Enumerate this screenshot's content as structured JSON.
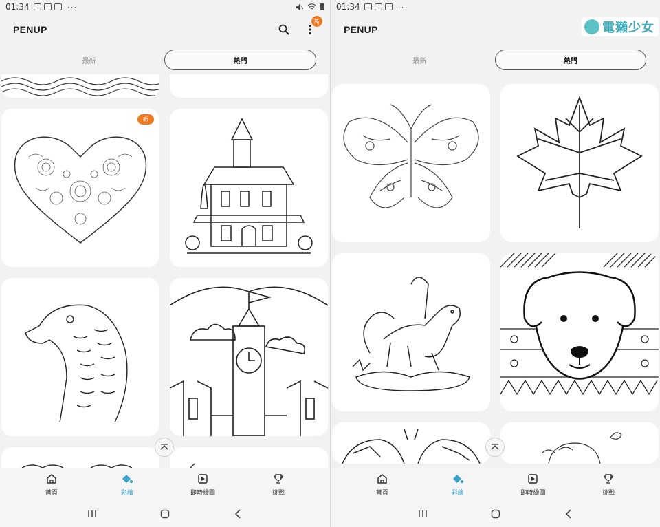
{
  "status_left": {
    "time": "01:34",
    "dots": "···"
  },
  "status_right": {
    "time": "01:34",
    "dots": "···"
  },
  "app": {
    "title": "PENUP",
    "new_badge": "新"
  },
  "tabs": {
    "latest": "最新",
    "popular": "熱門"
  },
  "card_badge": "新",
  "watermark": {
    "text": "電獺少女"
  },
  "nav": {
    "home": "首頁",
    "coloring": "彩繪",
    "live": "即時繪圖",
    "challenge": "挑戰"
  },
  "colors": {
    "accent": "#3aa3c8",
    "badge": "#f07a22",
    "background": "#f2f2f2"
  },
  "icons": [
    "search-icon",
    "more-icon",
    "home-icon",
    "coloring-icon",
    "live-drawing-icon",
    "trophy-icon",
    "recent-apps-icon",
    "home-circle-icon",
    "back-icon",
    "chevron-up-icon"
  ]
}
